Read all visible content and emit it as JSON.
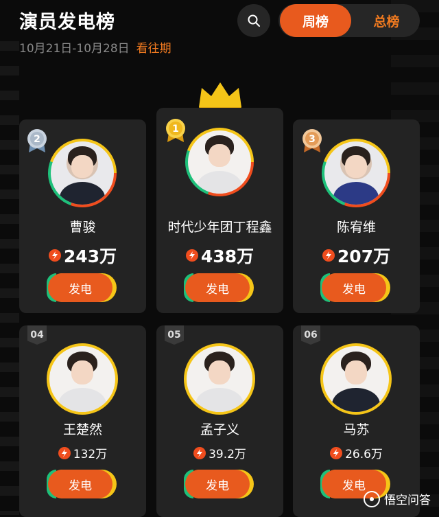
{
  "header": {
    "title": "演员发电榜",
    "date_range": "10月21日-10月28日",
    "past_link": "看往期"
  },
  "tabs": [
    {
      "label": "周榜",
      "active": true
    },
    {
      "label": "总榜",
      "active": false
    }
  ],
  "actors": [
    {
      "rank": "1",
      "name": "时代少年团丁程鑫",
      "score": "438万",
      "button": "发电"
    },
    {
      "rank": "2",
      "name": "曹骏",
      "score": "243万",
      "button": "发电"
    },
    {
      "rank": "3",
      "name": "陈宥维",
      "score": "207万",
      "button": "发电"
    },
    {
      "rank": "04",
      "name": "王楚然",
      "score": "132万",
      "button": "发电"
    },
    {
      "rank": "05",
      "name": "孟子义",
      "score": "39.2万",
      "button": "发电"
    },
    {
      "rank": "06",
      "name": "马苏",
      "score": "26.6万",
      "button": "发电"
    }
  ],
  "watermark": "悟空问答",
  "colors": {
    "accent": "#e85a1e",
    "gold": "#f5c518",
    "green": "#1ec07a",
    "card": "#232323",
    "background": "#0b0b0b"
  }
}
